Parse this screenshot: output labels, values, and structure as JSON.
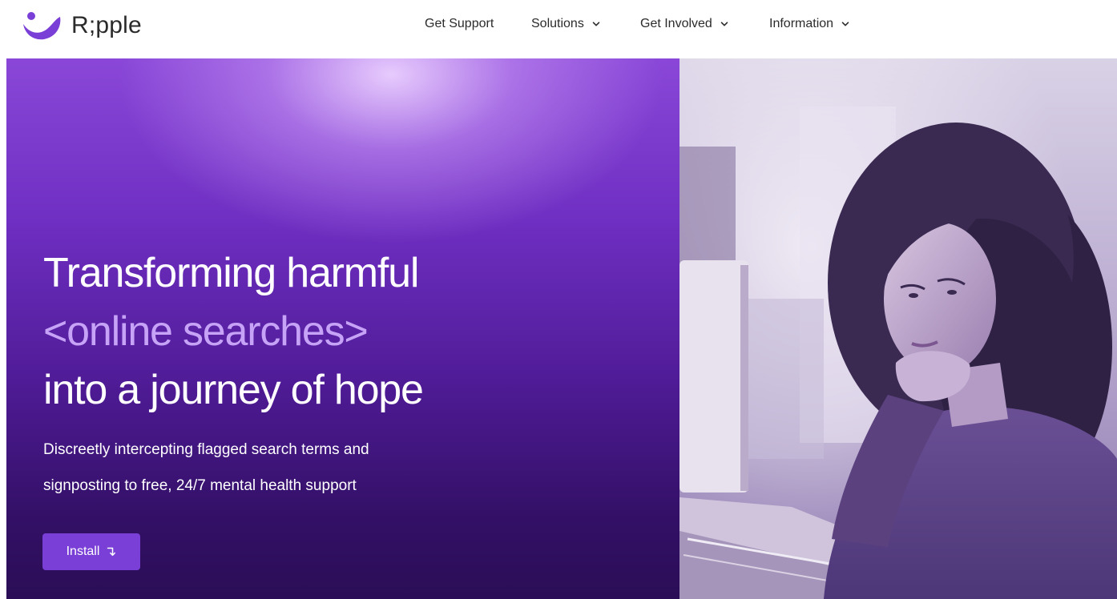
{
  "brand": {
    "name": "R;pple",
    "logo_icon": "ripple-wave-logo",
    "accent_color": "#7a3fd6"
  },
  "nav": {
    "items": [
      {
        "label": "Get Support",
        "has_dropdown": false
      },
      {
        "label": "Solutions",
        "has_dropdown": true
      },
      {
        "label": "Get Involved",
        "has_dropdown": true
      },
      {
        "label": "Information",
        "has_dropdown": true
      }
    ]
  },
  "hero": {
    "title_line1": "Transforming harmful",
    "title_line2": "<online searches>",
    "title_line3": "into a journey of hope",
    "subtitle_line1": "Discreetly intercepting flagged search terms and",
    "subtitle_line2": "signposting to free, 24/7 mental health support",
    "install_label": "Install",
    "install_icon": "arrow-turn-down-icon"
  },
  "colors": {
    "hero_top": "#8a47d8",
    "hero_bottom": "#2a0d56",
    "accent_text": "#c6a3f7"
  }
}
